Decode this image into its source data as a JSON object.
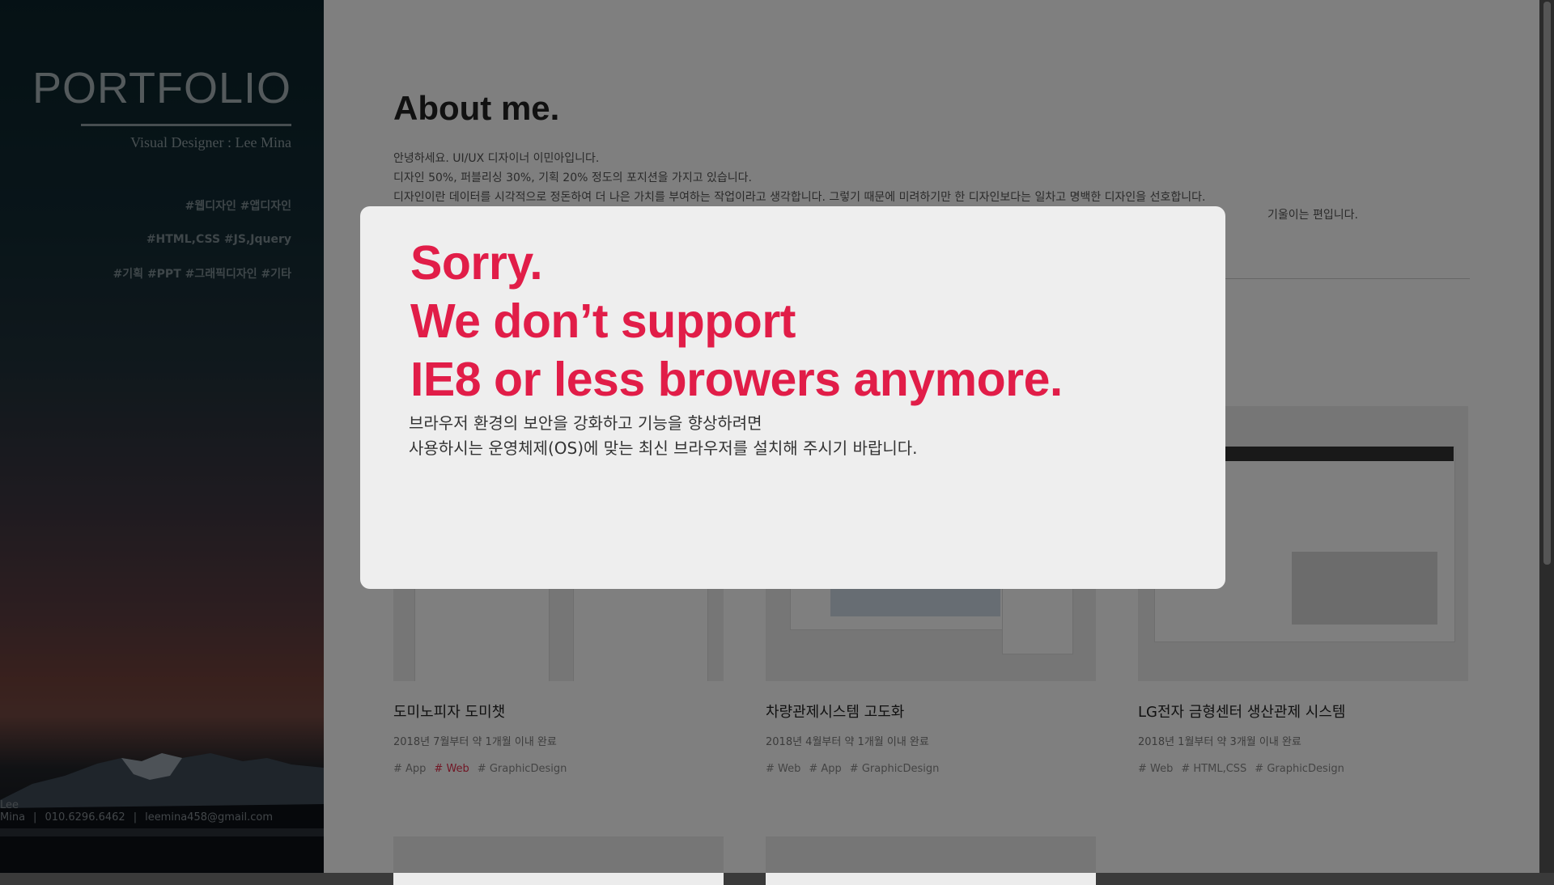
{
  "sidebar": {
    "logo": "PORTFOLIO",
    "subtitle": "Visual Designer : Lee Mina",
    "tags": [
      "#웹디자인  #앱디자인",
      "#HTML,CSS  #JS,Jquery",
      "#기획  #PPT  #그래픽디자인  #기타"
    ],
    "contact": {
      "name": "Lee Mina",
      "phone": "010.6296.6462",
      "email": "leemina458@gmail.com"
    }
  },
  "about": {
    "title": "About me.",
    "paragraphs": [
      "안녕하세요. UI/UX 디자이너 이민아입니다.",
      "디자인 50%, 퍼블리싱 30%, 기획 20% 정도의 포지션을 가지고 있습니다.",
      "디자인이란 데이터를 시각적으로 정돈하여 더 나은 가치를 부여하는 작업이라고 생각합니다. 그렇기 때문에 미려하기만 한 디자인보다는 일차고 명백한 디자인을 선호합니다.",
      "기울이는 편입니다."
    ]
  },
  "works": {
    "cards": [
      {
        "title": "도미노피자 도미챗",
        "period": "2018년 7월부터 약 1개월 이내 완료",
        "tags": [
          "# App",
          "# Web",
          "# GraphicDesign"
        ],
        "active_tag": "# Web"
      },
      {
        "title": "차량관제시스템 고도화",
        "period": "2018년 4월부터 약 1개월 이내 완료",
        "tags": [
          "# Web",
          "# App",
          "# GraphicDesign"
        ]
      },
      {
        "title": "LG전자 금형센터 생산관제 시스템",
        "period": "2018년 1월부터 약 3개월 이내 완료",
        "tags": [
          "# Web",
          "# HTML,CSS",
          "# GraphicDesign"
        ]
      }
    ]
  },
  "modal": {
    "heading": [
      "Sorry.",
      "We don’t support",
      "IE8 or less browers anymore."
    ],
    "message": [
      "브라우저 환경의 보안을 강화하고 기능을 향상하려면",
      "사용하시는 운영체제(OS)에 맞는 최신 브라우저를 설치해 주시기 바랍니다."
    ],
    "accent_color": "#e11d48"
  }
}
